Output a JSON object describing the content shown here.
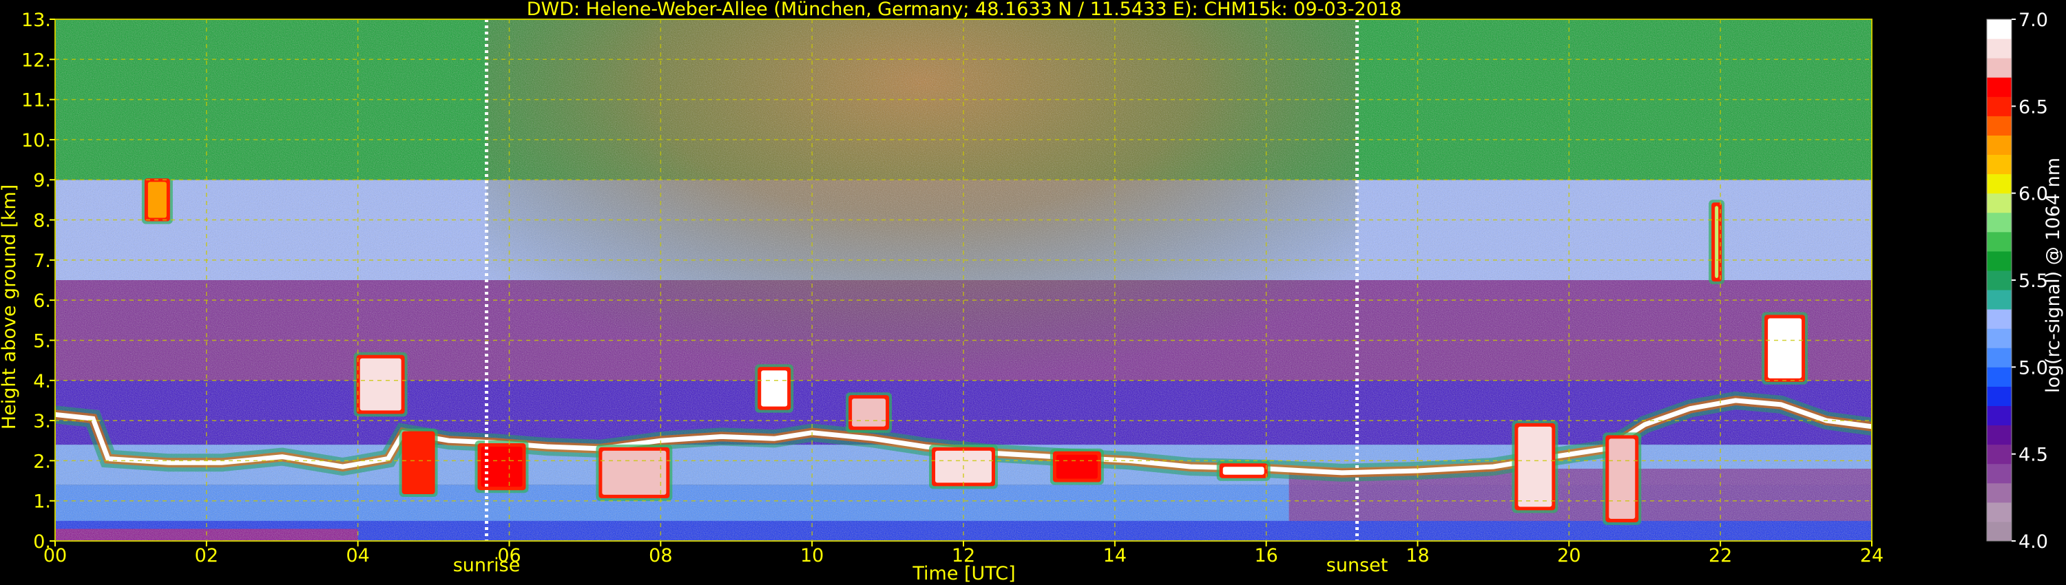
{
  "chart_data": {
    "type": "heatmap",
    "title": "DWD: Helene-Weber-Allee (München, Germany; 48.1633 N / 11.5433 E):    CHM15k: 09-03-2018",
    "xlabel": "Time [UTC]",
    "ylabel": "Height above ground [km]",
    "xlim": [
      0,
      24
    ],
    "ylim": [
      0,
      13
    ],
    "x_ticks": [
      0,
      2,
      4,
      6,
      8,
      10,
      12,
      14,
      16,
      18,
      20,
      22,
      24
    ],
    "x_tick_labels": [
      "00",
      "02",
      "04",
      "06",
      "08",
      "10",
      "12",
      "14",
      "16",
      "18",
      "20",
      "22",
      "24"
    ],
    "y_ticks": [
      0,
      1,
      2,
      3,
      4,
      5,
      6,
      7,
      8,
      9,
      10,
      11,
      12,
      13
    ],
    "y_tick_labels": [
      "0.",
      "1.",
      "2.",
      "3.",
      "4.",
      "5.",
      "6.",
      "7.",
      "8.",
      "9.",
      "10.",
      "11.",
      "12.",
      "13."
    ],
    "grid": true,
    "grid_color": "#c8c800",
    "vlines": [
      {
        "x": 5.7,
        "label": "sunrise",
        "color": "#ffffff"
      },
      {
        "x": 17.2,
        "label": "sunset",
        "color": "#ffffff"
      }
    ],
    "colorbar": {
      "label": "log(rc-signal) @ 1064 nm",
      "range": [
        4.0,
        7.0
      ],
      "ticks": [
        4.0,
        4.5,
        5.0,
        5.5,
        6.0,
        6.5,
        7.0
      ],
      "tick_labels": [
        "4.0",
        "4.5",
        "5.0",
        "5.5",
        "6.0",
        "6.5",
        "7.0"
      ],
      "colors": [
        "#a890a8",
        "#b498b4",
        "#a070a8",
        "#8a48a0",
        "#7a2894",
        "#60109a",
        "#3a10c8",
        "#1430f0",
        "#1e60ff",
        "#4a8cff",
        "#78a8ff",
        "#a0b8ff",
        "#30b0a0",
        "#20a060",
        "#10a030",
        "#40c050",
        "#80e080",
        "#c8f070",
        "#f0f000",
        "#ffc000",
        "#ffa000",
        "#ff6000",
        "#ff2000",
        "#ff0000",
        "#f0c0c0",
        "#f8e0e0",
        "#ffffff"
      ]
    },
    "cloud_base_height_km": [
      {
        "t": 0.0,
        "h": 3.15
      },
      {
        "t": 0.5,
        "h": 3.05
      },
      {
        "t": 0.7,
        "h": 2.05
      },
      {
        "t": 1.5,
        "h": 1.95
      },
      {
        "t": 2.2,
        "h": 1.95
      },
      {
        "t": 3.0,
        "h": 2.1
      },
      {
        "t": 3.8,
        "h": 1.85
      },
      {
        "t": 4.4,
        "h": 2.05
      },
      {
        "t": 4.6,
        "h": 2.7
      },
      {
        "t": 5.2,
        "h": 2.5
      },
      {
        "t": 5.8,
        "h": 2.45
      },
      {
        "t": 6.5,
        "h": 2.35
      },
      {
        "t": 7.2,
        "h": 2.3
      },
      {
        "t": 8.0,
        "h": 2.5
      },
      {
        "t": 8.8,
        "h": 2.6
      },
      {
        "t": 9.5,
        "h": 2.55
      },
      {
        "t": 10.0,
        "h": 2.7
      },
      {
        "t": 10.8,
        "h": 2.55
      },
      {
        "t": 11.5,
        "h": 2.35
      },
      {
        "t": 12.3,
        "h": 2.2
      },
      {
        "t": 13.2,
        "h": 2.1
      },
      {
        "t": 14.2,
        "h": 2.0
      },
      {
        "t": 15.0,
        "h": 1.85
      },
      {
        "t": 16.0,
        "h": 1.8
      },
      {
        "t": 17.0,
        "h": 1.7
      },
      {
        "t": 18.0,
        "h": 1.75
      },
      {
        "t": 19.0,
        "h": 1.85
      },
      {
        "t": 19.8,
        "h": 2.1
      },
      {
        "t": 20.5,
        "h": 2.3
      },
      {
        "t": 21.0,
        "h": 2.9
      },
      {
        "t": 21.6,
        "h": 3.3
      },
      {
        "t": 22.2,
        "h": 3.5
      },
      {
        "t": 22.8,
        "h": 3.4
      },
      {
        "t": 23.4,
        "h": 3.0
      },
      {
        "t": 24.0,
        "h": 2.85
      }
    ],
    "cloud_patches": [
      {
        "t0": 1.2,
        "t1": 1.5,
        "h0": 8.0,
        "h1": 9.0,
        "value": 6.3
      },
      {
        "t0": 4.0,
        "t1": 4.6,
        "h0": 3.2,
        "h1": 4.6,
        "value": 6.8
      },
      {
        "t0": 4.6,
        "t1": 5.0,
        "h0": 1.2,
        "h1": 2.7,
        "value": 6.5
      },
      {
        "t0": 5.6,
        "t1": 6.2,
        "h0": 1.3,
        "h1": 2.4,
        "value": 6.6
      },
      {
        "t0": 7.2,
        "t1": 8.1,
        "h0": 1.1,
        "h1": 2.3,
        "value": 6.7
      },
      {
        "t0": 9.3,
        "t1": 9.7,
        "h0": 3.3,
        "h1": 4.3,
        "value": 6.9
      },
      {
        "t0": 10.5,
        "t1": 11.0,
        "h0": 2.8,
        "h1": 3.6,
        "value": 6.7
      },
      {
        "t0": 11.6,
        "t1": 12.4,
        "h0": 1.4,
        "h1": 2.3,
        "value": 6.8
      },
      {
        "t0": 13.2,
        "t1": 13.8,
        "h0": 1.5,
        "h1": 2.2,
        "value": 6.6
      },
      {
        "t0": 15.4,
        "t1": 16.0,
        "h0": 1.6,
        "h1": 1.9,
        "value": 6.9
      },
      {
        "t0": 19.3,
        "t1": 19.8,
        "h0": 0.8,
        "h1": 2.9,
        "value": 6.8
      },
      {
        "t0": 20.5,
        "t1": 20.9,
        "h0": 0.5,
        "h1": 2.6,
        "value": 6.7
      },
      {
        "t0": 22.6,
        "t1": 23.1,
        "h0": 4.0,
        "h1": 5.6,
        "value": 6.9
      },
      {
        "t0": 21.9,
        "t1": 22.0,
        "h0": 6.5,
        "h1": 8.4,
        "value": 5.9
      }
    ]
  }
}
